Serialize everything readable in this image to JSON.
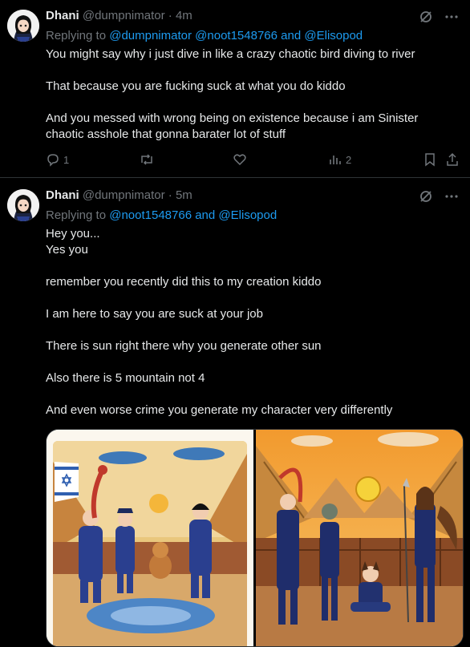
{
  "tweets": [
    {
      "name": "Dhani",
      "handle": "@dumpnimator",
      "time": "· 4m",
      "replying_prefix": "Replying to",
      "mentions": [
        "@dumpnimator",
        "@noot1548766",
        "@Elisopod"
      ],
      "and": "and",
      "lines": [
        "You might say why i just dive in like a crazy chaotic bird diving to river",
        "",
        "That because you are fucking suck at what you do kiddo",
        "",
        "And you messed with wrong being on existence because i am Sinister",
        "chaotic asshole that gonna barater lot of stuff"
      ],
      "reply_count": "1",
      "retweet_count": "",
      "like_count": "",
      "view_count": "2"
    },
    {
      "name": "Dhani",
      "handle": "@dumpnimator",
      "time": "· 5m",
      "replying_prefix": "Replying to",
      "mentions": [
        "@noot1548766",
        "@Elisopod"
      ],
      "and": "and",
      "lines": [
        "Hey you...",
        "Yes you",
        "",
        "remember you recently did this to my creation kiddo",
        "",
        "I am here to say you are suck at your job",
        "",
        "There is sun right there why you generate other sun",
        "",
        "Also  there is 5 mountain not 4",
        "",
        "And even worse crime you generate my character very differently"
      ]
    }
  ],
  "colors": {
    "link": "#1d9bf0",
    "muted": "#71767b",
    "text": "#e7e9ea",
    "divider": "#2f3336"
  }
}
